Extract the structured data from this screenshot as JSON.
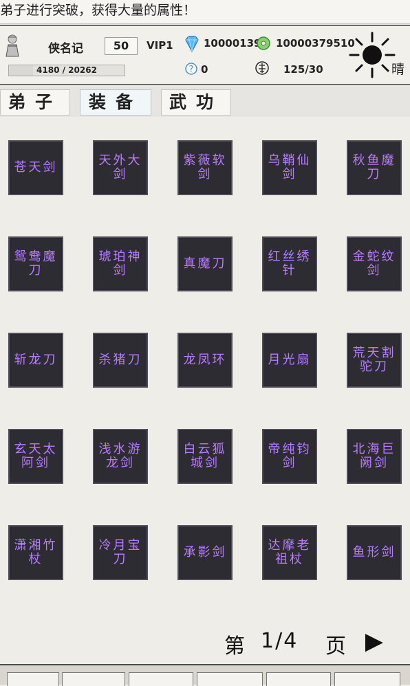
{
  "notice": {
    "text": "弟子进行突破，获得大量的属性！"
  },
  "player": {
    "name": "侠名记",
    "level": "50",
    "vip": "VIP1",
    "exp_text": "4180 / 20262",
    "exp_progress": 0.206,
    "gems": "100001395",
    "coins": "10000379510",
    "q_value": "0",
    "stamina": "125/30",
    "weather": "晴"
  },
  "tabs": [
    {
      "label": "弟子",
      "active": false
    },
    {
      "label": "装备",
      "active": true
    },
    {
      "label": "武功",
      "active": false
    }
  ],
  "items": [
    "苍天剑",
    "天外大剑",
    "紫薇软剑",
    "乌鞘仙剑",
    "秋鱼魔刀",
    "鸳鸯魔刀",
    "琥珀神剑",
    "真魔刀",
    "红丝绣针",
    "金蛇纹剑",
    "斩龙刀",
    "杀猪刀",
    "龙凤环",
    "月光扇",
    "荒天割驼刀",
    "玄天太阿剑",
    "浅水游龙剑",
    "白云狐城剑",
    "帝纯钧剑",
    "北海巨阙剑",
    "潇湘竹杖",
    "冷月宝刀",
    "承影剑",
    "达摩老祖杖",
    "鱼形剑"
  ],
  "pager": {
    "prefix": "第",
    "page": "1/4",
    "suffix": "页",
    "next_icon": "▶"
  },
  "colors": {
    "item_text": "#b97bff",
    "item_bg": "#2d2c33",
    "page_bg": "#efede8"
  }
}
